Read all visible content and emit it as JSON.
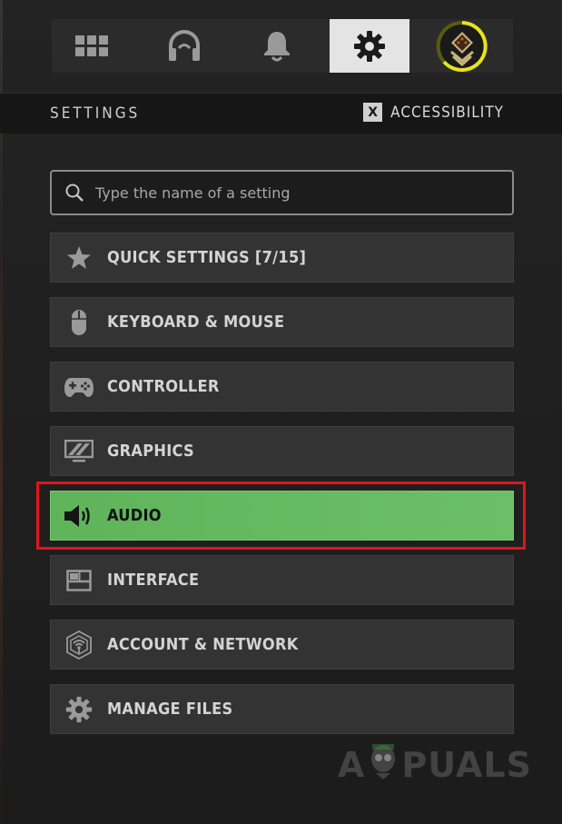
{
  "topnav": {
    "tabs": [
      {
        "icon": "grid-icon",
        "active": false
      },
      {
        "icon": "headset-icon",
        "active": false
      },
      {
        "icon": "bell-icon",
        "active": false
      },
      {
        "icon": "gear-icon",
        "active": true
      },
      {
        "icon": "rank-badge-icon",
        "active": false
      }
    ],
    "active_color": "#e4e4e4",
    "badge_ring_color": "#e8e21c"
  },
  "header": {
    "title": "SETTINGS",
    "accessibility_key": "X",
    "accessibility_label": "ACCESSIBILITY"
  },
  "search": {
    "placeholder": "Type the name of a setting",
    "value": ""
  },
  "menu": {
    "items": [
      {
        "label": "QUICK SETTINGS [7/15]",
        "icon": "star-icon",
        "selected": false
      },
      {
        "label": "KEYBOARD & MOUSE",
        "icon": "mouse-icon",
        "selected": false
      },
      {
        "label": "CONTROLLER",
        "icon": "gamepad-icon",
        "selected": false
      },
      {
        "label": "GRAPHICS",
        "icon": "monitor-icon",
        "selected": false
      },
      {
        "label": "AUDIO",
        "icon": "speaker-icon",
        "selected": true
      },
      {
        "label": "INTERFACE",
        "icon": "layout-icon",
        "selected": false
      },
      {
        "label": "ACCOUNT & NETWORK",
        "icon": "network-icon",
        "selected": false
      },
      {
        "label": "MANAGE FILES",
        "icon": "gear-icon",
        "selected": false
      }
    ],
    "selected_color": "#66ba61",
    "highlight_color": "#e0141c"
  },
  "watermark": {
    "left": "A",
    "right": "PUALS"
  }
}
